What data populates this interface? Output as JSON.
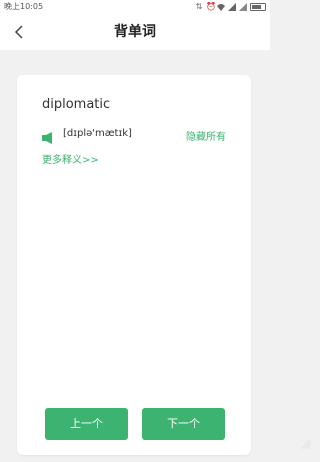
{
  "status_bar": {
    "time": "晚上10:05"
  },
  "header": {
    "title": "背单词"
  },
  "card": {
    "word": "diplomatic",
    "phonetic": "[dɪplə'mætɪk]",
    "hide_all_label": "隐藏所有",
    "more_definitions_label": "更多释义>>"
  },
  "buttons": {
    "prev_label": "上一个",
    "next_label": "下一个"
  },
  "colors": {
    "accent": "#3cb371",
    "background": "#f1f1f1",
    "card": "#ffffff"
  },
  "icons": {
    "back": "chevron-left-icon",
    "speaker": "speaker-icon"
  }
}
